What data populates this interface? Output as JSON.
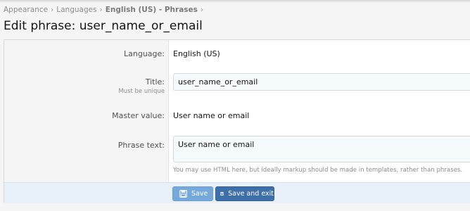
{
  "breadcrumb": {
    "items": [
      "Appearance",
      "Languages",
      "English (US)",
      "Phrases"
    ],
    "separator": "›"
  },
  "page": {
    "title": "Edit phrase: user_name_or_email"
  },
  "form": {
    "language": {
      "label": "Language:",
      "value": "English (US)"
    },
    "title": {
      "label": "Title:",
      "hint": "Must be unique",
      "value": "user_name_or_email"
    },
    "master": {
      "label": "Master value:",
      "value": "User name or email"
    },
    "phrase_text": {
      "label": "Phrase text:",
      "value": "User name or email",
      "explain": "You may use HTML here, but ideally markup should be made in templates, rather than phrases."
    }
  },
  "buttons": {
    "save": "Save",
    "save_exit": "Save and exit",
    "icon": "save-disk-icon"
  },
  "colors": {
    "save_button": "#75a9dc",
    "save_exit_button": "#3e6fa8",
    "submit_row": "#e8f1fa",
    "input_bg": "#f5fafd"
  }
}
